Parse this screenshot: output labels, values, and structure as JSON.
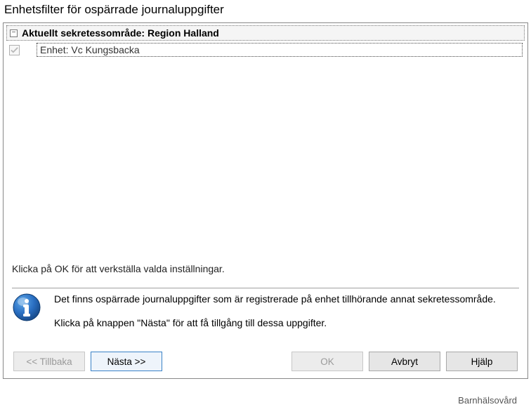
{
  "window": {
    "title": "Enhetsfilter för ospärrade journaluppgifter"
  },
  "tree": {
    "header_label": "Aktuellt sekretessområde: Region Halland",
    "item_checked": true,
    "item_label": "Enhet: Vc Kungsbacka"
  },
  "instruction": "Klicka på OK för att verkställa valda inställningar.",
  "info": {
    "line1": "Det finns ospärrade journaluppgifter som är registrerade på enhet tillhörande annat sekretessområde.",
    "line2": "Klicka på knappen \"Nästa\" för att få tillgång till dessa uppgifter."
  },
  "buttons": {
    "back": "<< Tillbaka",
    "next": "Nästa >>",
    "ok": "OK",
    "cancel": "Avbryt",
    "help": "Hjälp"
  },
  "footer_fragment": "Barnhälsovård"
}
